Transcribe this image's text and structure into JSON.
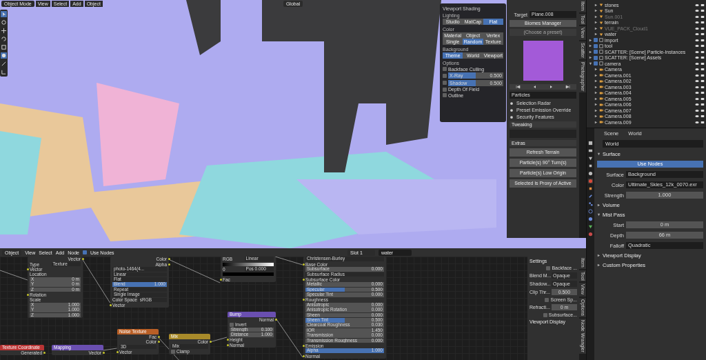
{
  "viewport": {
    "header": {
      "mode": "Object Mode",
      "menus": [
        "View",
        "Select",
        "Add",
        "Object"
      ],
      "orientation": "Global"
    },
    "shading_popup": {
      "title": "Viewport Shading",
      "lighting": {
        "label": "Lighting",
        "options": [
          {
            "label": "Studio",
            "selected": false
          },
          {
            "label": "MatCap",
            "selected": false
          },
          {
            "label": "Flat",
            "selected": true
          }
        ]
      },
      "color": {
        "label": "Color",
        "options": [
          {
            "label": "Material",
            "selected": false
          },
          {
            "label": "Object",
            "selected": false
          },
          {
            "label": "Vertex",
            "selected": false
          },
          {
            "label": "Single",
            "selected": false
          },
          {
            "label": "Random",
            "selected": true
          },
          {
            "label": "Texture",
            "selected": false
          }
        ]
      },
      "background": {
        "label": "Background",
        "options": [
          {
            "label": "Theme",
            "selected": true
          },
          {
            "label": "World",
            "selected": false
          },
          {
            "label": "Viewport",
            "selected": false
          }
        ]
      },
      "options": {
        "label": "Options",
        "items": [
          {
            "kind": "check",
            "label": "Backface Culling",
            "checked": false
          },
          {
            "kind": "slider",
            "label": "X-Ray",
            "checked": false,
            "level": 0.5,
            "reading": "0.500"
          },
          {
            "kind": "slider",
            "label": "Shadow",
            "checked": false,
            "level": 0.5,
            "reading": "0.500"
          },
          {
            "kind": "check",
            "label": "Depth Of Field",
            "checked": false
          },
          {
            "kind": "check",
            "label": "Outline",
            "checked": false
          }
        ]
      }
    },
    "side_panel": {
      "target_label": "Target",
      "target": "Plane.008",
      "biomes_button": "Biomes Manager",
      "preset": "(Choose a preset)",
      "particles": "Particles",
      "subpanels": [
        "Selection Radar",
        "Preset Emission Override",
        "Security Features"
      ],
      "tweaking": "Tweaking",
      "extras": {
        "label": "Extras",
        "buttons": [
          "Refresh Terrain",
          "Particle(s) 90° Turn(s)",
          "Particle(s) Low Origin",
          "Selected is Proxy of Active"
        ]
      },
      "tabs": [
        "Item",
        "Tool",
        "View",
        "Scatter",
        "Photographer"
      ]
    }
  },
  "node_editor": {
    "header": {
      "mode": "Object",
      "menus": [
        "View",
        "Select",
        "Add",
        "Node"
      ],
      "use_nodes": {
        "label": "Use Nodes",
        "checked": true
      },
      "slot": "Slot 1",
      "material": "water"
    },
    "nodes": [
      {
        "rows": [
          {
            "kind": "out",
            "label": "Vector"
          },
          {
            "kind": "prop",
            "label": "Type",
            "value": "Texture"
          },
          {
            "kind": "in",
            "label": "Vector"
          },
          {
            "kind": "label",
            "label": "Location"
          },
          {
            "kind": "value",
            "label": "X",
            "value": "0 m"
          },
          {
            "kind": "value",
            "label": "Y",
            "value": "0 m"
          },
          {
            "kind": "value",
            "label": "Z",
            "value": "0 m"
          },
          {
            "kind": "in",
            "label": "Rotation"
          },
          {
            "kind": "label",
            "label": "Scale"
          },
          {
            "kind": "value",
            "label": "X",
            "value": "1.000"
          },
          {
            "kind": "value",
            "label": "Y",
            "value": "1.000"
          },
          {
            "kind": "value",
            "label": "Z",
            "value": "1.000"
          }
        ]
      },
      {
        "rows": [
          {
            "kind": "out",
            "label": "Color"
          },
          {
            "kind": "out",
            "label": "Alpha"
          },
          {
            "kind": "field",
            "label": "photo-1464(4..."
          },
          {
            "kind": "field",
            "label": "Linear"
          },
          {
            "kind": "field",
            "label": "Flat"
          },
          {
            "kind": "value",
            "label": "Blend",
            "value": "1.000",
            "level": 1
          },
          {
            "kind": "field",
            "label": "Repeat"
          },
          {
            "kind": "field",
            "label": "Single Image"
          },
          {
            "kind": "prop",
            "label": "Color Space",
            "value": "sRGB"
          },
          {
            "kind": "in",
            "label": "Vector"
          }
        ]
      },
      {
        "rows": [
          {
            "kind": "prop",
            "label": "RGB",
            "value": "Linear"
          },
          {
            "kind": "ramp"
          },
          {
            "kind": "prop",
            "label": "0",
            "value": "Pos 0.000"
          },
          {
            "kind": "swatch"
          },
          {
            "kind": "in",
            "label": "Fac"
          }
        ]
      },
      {
        "rows": [
          {
            "kind": "field",
            "label": "Christensen-Burley"
          },
          {
            "kind": "in",
            "label": "Base Color"
          },
          {
            "kind": "value",
            "label": "Subsurface",
            "value": "0.000"
          },
          {
            "kind": "field",
            "label": "Subsurface Radius"
          },
          {
            "kind": "in",
            "label": "Subsurface Color"
          },
          {
            "kind": "value",
            "label": "Metallic",
            "value": "0.000"
          },
          {
            "kind": "value",
            "label": "Specular",
            "value": "0.500",
            "level": 0.5
          },
          {
            "kind": "value",
            "label": "Specular Tint",
            "value": "0.000"
          },
          {
            "kind": "in",
            "label": "Roughness"
          },
          {
            "kind": "value",
            "label": "Anisotropic",
            "value": "0.000"
          },
          {
            "kind": "value",
            "label": "Anisotropic Rotation",
            "value": "0.000"
          },
          {
            "kind": "value",
            "label": "Sheen",
            "value": "0.000"
          },
          {
            "kind": "value",
            "label": "Sheen Tint",
            "value": "0.500",
            "level": 0.5
          },
          {
            "kind": "value",
            "label": "Clearcoat Roughness",
            "value": "0.030"
          },
          {
            "kind": "value",
            "label": "IOR",
            "value": "1.450"
          },
          {
            "kind": "value",
            "label": "Transmission",
            "value": "0.000"
          },
          {
            "kind": "value",
            "label": "Transmission Roughness",
            "value": "0.000"
          },
          {
            "kind": "in",
            "label": "Emission"
          },
          {
            "kind": "value",
            "label": "Alpha",
            "value": "1.000",
            "level": 1
          },
          {
            "kind": "in",
            "label": "Normal"
          }
        ]
      },
      {
        "title": "Texture Coordinate",
        "color": "#b83434",
        "rows": [
          {
            "kind": "out",
            "label": "Generated"
          }
        ]
      },
      {
        "title": "Mapping",
        "color": "#6a4fb0",
        "rows": [
          {
            "kind": "out",
            "label": "Vector"
          }
        ]
      },
      {
        "title": "Noise Texture",
        "color": "#b85f26",
        "rows": [
          {
            "kind": "out",
            "label": "Fac"
          },
          {
            "kind": "out",
            "label": "Color"
          },
          {
            "kind": "field",
            "label": "3D"
          },
          {
            "kind": "in",
            "label": "Vector"
          }
        ]
      },
      {
        "title": "Mix",
        "color": "#a88a2a",
        "rows": [
          {
            "kind": "out",
            "label": "Color"
          },
          {
            "kind": "field",
            "label": "Mix"
          },
          {
            "kind": "check",
            "label": "Clamp",
            "checked": false
          }
        ]
      },
      {
        "title": "Bump",
        "color": "#6a4fb0",
        "rows": [
          {
            "kind": "out",
            "label": "Normal"
          },
          {
            "kind": "check",
            "label": "Invert",
            "checked": false
          },
          {
            "kind": "value",
            "label": "Strength",
            "value": "0.100"
          },
          {
            "kind": "value",
            "label": "Distance",
            "value": "1.000"
          },
          {
            "kind": "in",
            "label": "Height"
          },
          {
            "kind": "in",
            "label": "Normal"
          }
        ]
      }
    ],
    "sidebar": {
      "title": "Settings",
      "rows": [
        {
          "kind": "check",
          "label": "Backface ...",
          "checked": false
        },
        {
          "kind": "prop",
          "label": "Blend M...",
          "value": "Opaque"
        },
        {
          "kind": "prop",
          "label": "Shadow...",
          "value": "Opaque"
        },
        {
          "kind": "num",
          "label": "Clip Thr...",
          "value": "0.500"
        },
        {
          "kind": "check",
          "label": "Screen Sp...",
          "checked": false
        },
        {
          "kind": "num",
          "label": "Refracti...",
          "value": "0 m"
        },
        {
          "kind": "check",
          "label": "Subsurface...",
          "checked": false
        }
      ],
      "collapsed": "Viewport Display",
      "tabs": [
        "Item",
        "Tool",
        "View",
        "Options",
        "Node Wrangler"
      ]
    }
  },
  "outliner": {
    "items": [
      {
        "kind": "object",
        "name": "stones",
        "disabled": false,
        "expanded": false
      },
      {
        "kind": "object",
        "name": "Sun",
        "disabled": false,
        "expanded": false
      },
      {
        "kind": "object",
        "name": "Sun.001",
        "disabled": true,
        "expanded": false
      },
      {
        "kind": "object",
        "name": "terrain",
        "disabled": false,
        "expanded": false
      },
      {
        "kind": "object",
        "name": "VUE_PACK_Cloud1",
        "disabled": true,
        "expanded": false
      },
      {
        "kind": "object",
        "name": "water",
        "disabled": false,
        "expanded": false
      },
      {
        "kind": "collection",
        "name": "import",
        "disabled": false,
        "checked": true,
        "expanded": false
      },
      {
        "kind": "collection",
        "name": "tool",
        "disabled": false,
        "checked": true,
        "expanded": false
      },
      {
        "kind": "collection",
        "name": "SCATTER: [Scene] Particle-Instances",
        "disabled": false,
        "checked": true,
        "expanded": false
      },
      {
        "kind": "collection",
        "name": "SCATTER: [Scene] Assets",
        "disabled": false,
        "checked": true,
        "expanded": false
      },
      {
        "kind": "collection",
        "name": "camera",
        "disabled": false,
        "checked": true,
        "expanded": true,
        "children": [
          {
            "kind": "camera",
            "name": "Camera",
            "disabled": false
          },
          {
            "kind": "camera",
            "name": "Camera.001",
            "disabled": false
          },
          {
            "kind": "camera",
            "name": "Camera.002",
            "disabled": false
          },
          {
            "kind": "camera",
            "name": "Camera.003",
            "disabled": false
          },
          {
            "kind": "camera",
            "name": "Camera.004",
            "disabled": false
          },
          {
            "kind": "camera",
            "name": "Camera.005",
            "disabled": false
          },
          {
            "kind": "camera",
            "name": "Camera.006",
            "disabled": false
          },
          {
            "kind": "camera",
            "name": "Camera.007",
            "disabled": false
          },
          {
            "kind": "camera",
            "name": "Camera.008",
            "disabled": false
          },
          {
            "kind": "camera",
            "name": "Camera.009",
            "disabled": false
          }
        ]
      }
    ]
  },
  "properties": {
    "breadcrumb": [
      "Scene",
      "World"
    ],
    "world": "World",
    "panels": [
      {
        "title": "Surface",
        "expanded": true,
        "rows": [
          {
            "kind": "button",
            "label": "Use Nodes"
          },
          {
            "kind": "prop",
            "label": "Surface",
            "value": "Background"
          },
          {
            "kind": "prop",
            "label": "Color",
            "value": "Ultimate_Skies_12k_0070.exr"
          },
          {
            "kind": "num",
            "label": "Strength",
            "value": "1.000"
          }
        ]
      },
      {
        "title": "Volume",
        "expanded": false
      },
      {
        "title": "Mist Pass",
        "expanded": true,
        "rows": [
          {
            "kind": "num",
            "label": "Start",
            "value": "0 m"
          },
          {
            "kind": "num",
            "label": "Depth",
            "value": "66 m"
          },
          {
            "kind": "prop",
            "label": "Falloff",
            "value": "Quadratic"
          }
        ]
      },
      {
        "title": "Viewport Display",
        "expanded": false
      },
      {
        "title": "Custom Properties",
        "expanded": false
      }
    ]
  }
}
